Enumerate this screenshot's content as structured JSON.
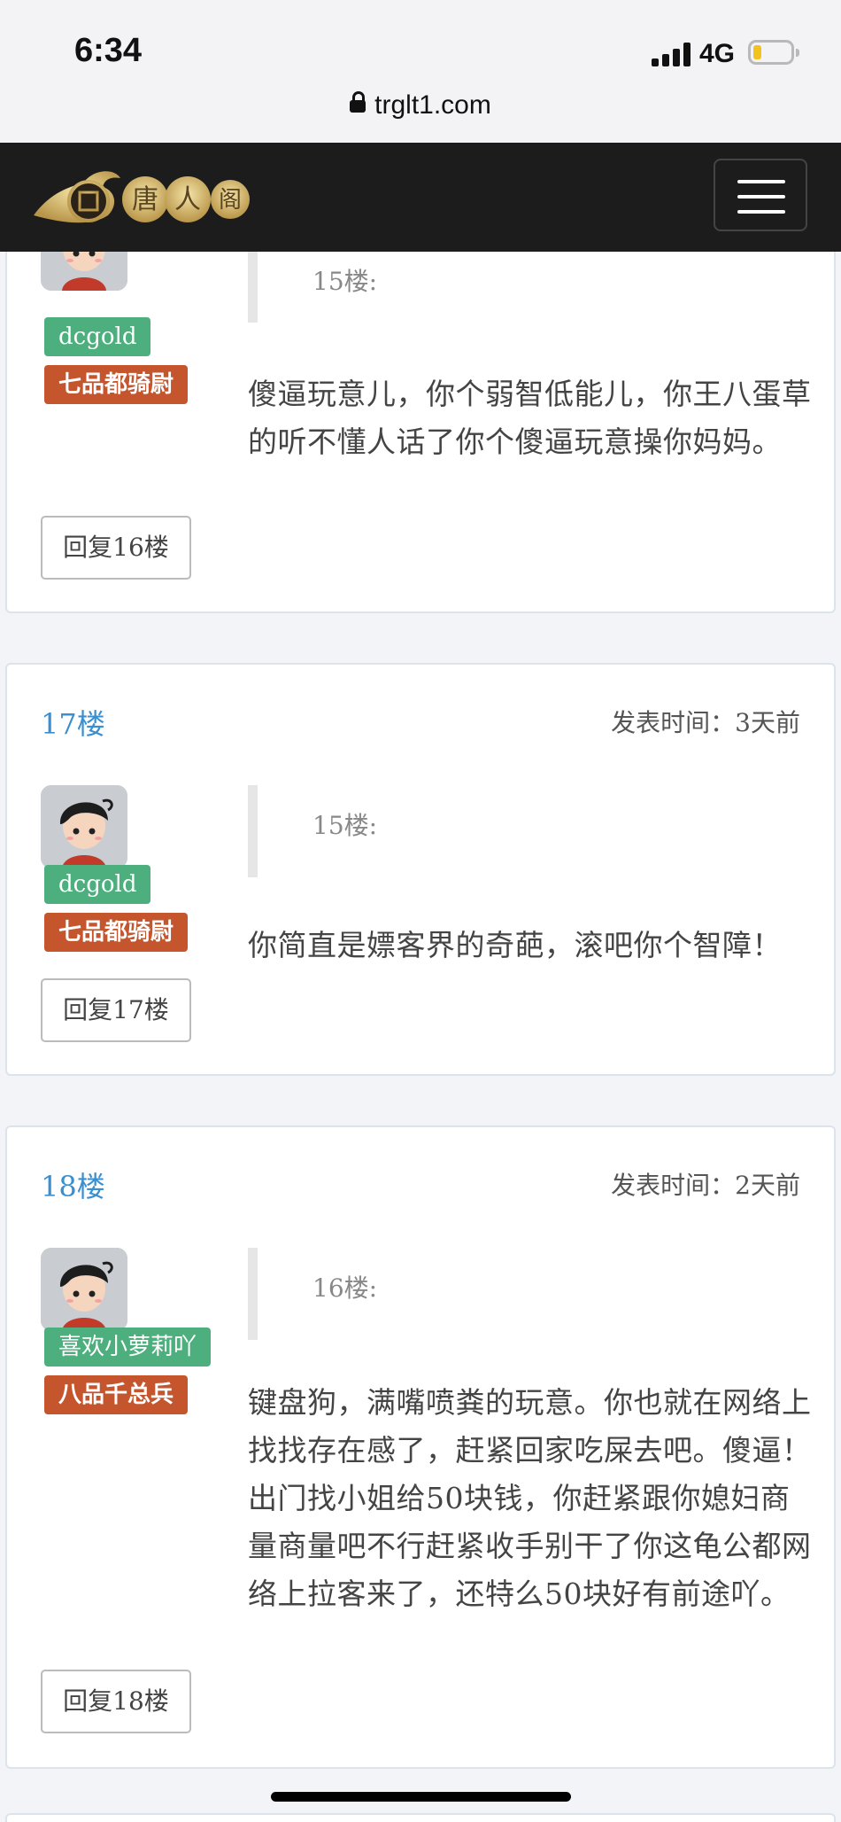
{
  "status": {
    "time": "6:34",
    "network": "4G",
    "url": "trglt1.com"
  },
  "nav": {
    "logo_text": "唐人阁"
  },
  "posts": [
    {
      "floor": "",
      "time": "",
      "quote": "15楼:",
      "user": "dcgold",
      "rank": "七品都骑尉",
      "content": "傻逼玩意儿，你个弱智低能儿，你王八蛋草的听不懂人话了你个傻逼玩意操你妈妈。",
      "reply": "回复16楼"
    },
    {
      "floor": "17楼",
      "time": "发表时间：3天前",
      "quote": "15楼:",
      "user": "dcgold",
      "rank": "七品都骑尉",
      "content": "你简直是嫖客界的奇葩，滚吧你个智障！",
      "reply": "回复17楼"
    },
    {
      "floor": "18楼",
      "time": "发表时间：2天前",
      "quote": "16楼:",
      "user": "喜欢小萝莉吖",
      "rank": "八品千总兵",
      "content": "键盘狗，满嘴喷粪的玩意。你也就在网络上找找存在感了，赶紧回家吃屎去吧。傻逼！出门找小姐给50块钱，你赶紧跟你媳妇商量商量吧不行赶紧收手别干了你这龟公都网络上拉客来了，还特么50块好有前途吖。",
      "reply": "回复18楼"
    }
  ]
}
